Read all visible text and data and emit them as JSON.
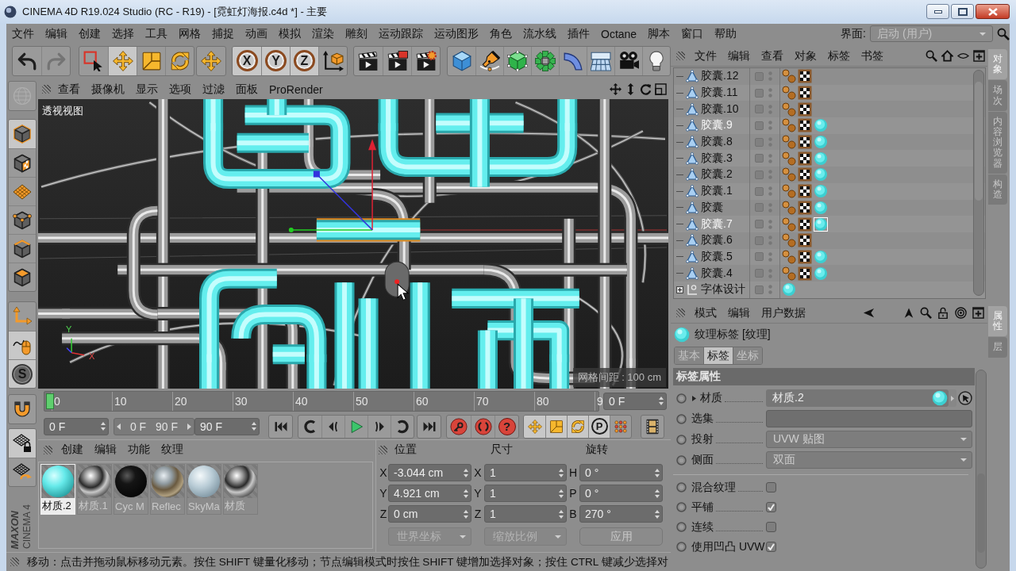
{
  "window": {
    "title": "CINEMA 4D R19.024 Studio (RC - R19) - [霓虹灯海报.c4d *] - 主要"
  },
  "menu_bar": {
    "items": [
      "文件",
      "编辑",
      "创建",
      "选择",
      "工具",
      "网格",
      "捕捉",
      "动画",
      "模拟",
      "渲染",
      "雕刻",
      "运动跟踪",
      "运动图形",
      "角色",
      "流水线",
      "插件",
      "Octane",
      "脚本",
      "窗口",
      "帮助"
    ],
    "layout_label": "界面:",
    "layout_value": "启动 (用户)"
  },
  "toolbar": {
    "groups": [
      [
        {
          "kind": "undo",
          "selected": false,
          "disabled": false
        },
        {
          "kind": "redo",
          "selected": false,
          "disabled": true
        }
      ],
      [
        {
          "kind": "select",
          "selected": false
        },
        {
          "kind": "move",
          "selected": true
        },
        {
          "kind": "scale",
          "selected": false
        },
        {
          "kind": "rotate",
          "selected": false
        }
      ],
      [
        {
          "kind": "move",
          "selected": false
        }
      ],
      [
        {
          "kind": "axis",
          "label": "X",
          "selected": true
        },
        {
          "kind": "axis",
          "label": "Y",
          "selected": true
        },
        {
          "kind": "axis",
          "label": "Z",
          "selected": true
        },
        {
          "kind": "world",
          "selected": false
        }
      ],
      [
        {
          "kind": "clapper",
          "selected": false
        },
        {
          "kind": "viewer",
          "selected": false
        },
        {
          "kind": "settings",
          "selected": false
        }
      ],
      [
        {
          "kind": "cube",
          "selected": false
        },
        {
          "kind": "pen",
          "selected": false
        },
        {
          "kind": "subdivide",
          "selected": false
        },
        {
          "kind": "cloner",
          "selected": false
        },
        {
          "kind": "bend",
          "selected": false
        },
        {
          "kind": "floor",
          "selected": false
        },
        {
          "kind": "camera",
          "selected": false
        },
        {
          "kind": "light",
          "selected": false
        }
      ]
    ]
  },
  "side_tools": {
    "groups": [
      [
        {
          "kind": "editable",
          "selected": false,
          "disabled": true
        }
      ],
      [
        {
          "kind": "model",
          "selected": true
        },
        {
          "kind": "texture",
          "selected": false
        },
        {
          "kind": "workplane",
          "selected": false
        },
        {
          "kind": "points",
          "selected": false
        },
        {
          "kind": "edges",
          "selected": false
        },
        {
          "kind": "polygons",
          "selected": false
        }
      ],
      [
        {
          "kind": "origin",
          "selected": false
        },
        {
          "kind": "tweak",
          "selected": true
        },
        {
          "kind": "solo",
          "label": "S",
          "selected": true
        }
      ],
      [
        {
          "kind": "snap",
          "selected": false
        }
      ],
      [
        {
          "kind": "lock",
          "selected": true
        },
        {
          "kind": "planar",
          "selected": false
        }
      ]
    ]
  },
  "logo": {
    "brand": "MAXON",
    "product": "CINEMA 4"
  },
  "viewport": {
    "menu": [
      "查看",
      "摄像机",
      "显示",
      "选项",
      "过滤",
      "面板",
      "ProRender"
    ],
    "camera_label": "透视视图",
    "axis_labels": [
      "Y",
      "X"
    ],
    "grid_spacing": "网格间距 : 100 cm"
  },
  "timeline": {
    "ticks": [
      "0",
      "10",
      "20",
      "30",
      "40",
      "50",
      "60",
      "70",
      "80",
      "9"
    ],
    "level": 0,
    "current_frame": "0 F"
  },
  "playback": {
    "start": "0 F",
    "preview": {
      "start": "0 F",
      "end": "90 F",
      "disabled": true
    },
    "end": "90 F",
    "record": [
      {
        "kind": "key"
      },
      {
        "kind": "auto"
      },
      {
        "kind": "pick",
        "label": "?"
      }
    ],
    "key_modes": [
      {
        "kind": "move",
        "selected": true
      },
      {
        "kind": "scale",
        "selected": true
      },
      {
        "kind": "rotate",
        "selected": true
      },
      {
        "kind": "param",
        "label": "P",
        "selected": true
      },
      {
        "kind": "points",
        "selected": false
      }
    ]
  },
  "materials": {
    "menu": [
      "创建",
      "编辑",
      "功能",
      "纹理"
    ],
    "items": [
      {
        "name": "材质.2",
        "kind": "glow",
        "selected": true
      },
      {
        "name": "材质.1",
        "kind": "chrome",
        "selected": false
      },
      {
        "name": "Cyc M",
        "kind": "black",
        "selected": false
      },
      {
        "name": "Reflec",
        "kind": "landscape",
        "selected": false
      },
      {
        "name": "SkyMa",
        "kind": "sky",
        "selected": false
      },
      {
        "name": "材质",
        "kind": "chrome",
        "selected": false
      }
    ]
  },
  "coordinates": {
    "headers": [
      "位置",
      "尺寸",
      "旋转"
    ],
    "rows": [
      {
        "cells": [
          {
            "axis": "X",
            "value": "-3.044 cm"
          },
          {
            "axis": "X",
            "value": "1"
          },
          {
            "axis": "H",
            "value": "0 °"
          }
        ]
      },
      {
        "cells": [
          {
            "axis": "Y",
            "value": "4.921 cm"
          },
          {
            "axis": "Y",
            "value": "1"
          },
          {
            "axis": "P",
            "value": "0 °"
          }
        ]
      },
      {
        "cells": [
          {
            "axis": "Z",
            "value": "0 cm"
          },
          {
            "axis": "Z",
            "value": "1"
          },
          {
            "axis": "B",
            "value": "270 °"
          }
        ]
      }
    ],
    "space": "世界坐标",
    "scale": "缩放比例",
    "apply": "应用"
  },
  "status_bar": {
    "text": "移动：点击并拖动鼠标移动元素。按住 SHIFT 键量化移动；节点编辑模式时按住 SHIFT 键增加选择对象；按住 CTRL 键减少选择对"
  },
  "objects": {
    "menu": [
      "文件",
      "编辑",
      "查看",
      "对象",
      "标签",
      "书签"
    ],
    "rows": [
      {
        "name": "胶囊.12",
        "kind": "capsule",
        "selected": false,
        "tags": [
          {
            "kind": "orbs",
            "selected": false
          },
          {
            "kind": "checker",
            "selected": false
          }
        ]
      },
      {
        "name": "胶囊.11",
        "kind": "capsule",
        "selected": false,
        "tags": [
          {
            "kind": "orbs",
            "selected": false
          },
          {
            "kind": "checker",
            "selected": false
          }
        ]
      },
      {
        "name": "胶囊.10",
        "kind": "capsule",
        "selected": false,
        "tags": [
          {
            "kind": "orbs",
            "selected": false
          },
          {
            "kind": "checker",
            "selected": false
          }
        ]
      },
      {
        "name": "胶囊.9",
        "kind": "capsule",
        "selected": true,
        "tags": [
          {
            "kind": "orbs",
            "selected": false
          },
          {
            "kind": "checker",
            "selected": false
          },
          {
            "kind": "material",
            "selected": false
          }
        ]
      },
      {
        "name": "胶囊.8",
        "kind": "capsule",
        "selected": false,
        "tags": [
          {
            "kind": "orbs",
            "selected": false
          },
          {
            "kind": "checker",
            "selected": false
          },
          {
            "kind": "material",
            "selected": false
          }
        ]
      },
      {
        "name": "胶囊.3",
        "kind": "capsule",
        "selected": false,
        "tags": [
          {
            "kind": "orbs",
            "selected": false
          },
          {
            "kind": "checker",
            "selected": false
          },
          {
            "kind": "material",
            "selected": false
          }
        ]
      },
      {
        "name": "胶囊.2",
        "kind": "capsule",
        "selected": false,
        "tags": [
          {
            "kind": "orbs",
            "selected": false
          },
          {
            "kind": "checker",
            "selected": false
          },
          {
            "kind": "material",
            "selected": false
          }
        ]
      },
      {
        "name": "胶囊.1",
        "kind": "capsule",
        "selected": false,
        "tags": [
          {
            "kind": "orbs",
            "selected": false
          },
          {
            "kind": "checker",
            "selected": false
          },
          {
            "kind": "material",
            "selected": false
          }
        ]
      },
      {
        "name": "胶囊",
        "kind": "capsule",
        "selected": false,
        "tags": [
          {
            "kind": "orbs",
            "selected": false
          },
          {
            "kind": "checker",
            "selected": false
          },
          {
            "kind": "material",
            "selected": false
          }
        ]
      },
      {
        "name": "胶囊.7",
        "kind": "capsule",
        "selected": true,
        "tags": [
          {
            "kind": "orbs",
            "selected": false
          },
          {
            "kind": "checker",
            "selected": false
          },
          {
            "kind": "material",
            "selected": true
          }
        ]
      },
      {
        "name": "胶囊.6",
        "kind": "capsule",
        "selected": false,
        "tags": [
          {
            "kind": "orbs",
            "selected": false
          },
          {
            "kind": "checker",
            "selected": false
          }
        ]
      },
      {
        "name": "胶囊.5",
        "kind": "capsule",
        "selected": false,
        "tags": [
          {
            "kind": "orbs",
            "selected": false
          },
          {
            "kind": "checker",
            "selected": false
          },
          {
            "kind": "material",
            "selected": false
          }
        ]
      },
      {
        "name": "胶囊.4",
        "kind": "capsule",
        "selected": false,
        "tags": [
          {
            "kind": "orbs",
            "selected": false
          },
          {
            "kind": "checker",
            "selected": false
          },
          {
            "kind": "material",
            "selected": false
          }
        ]
      },
      {
        "name": "字体设计",
        "kind": "null",
        "expanded": false,
        "selected": false,
        "tags": [
          {
            "kind": "material",
            "selected": false
          }
        ]
      }
    ],
    "side_tabs": [
      {
        "label": "对象",
        "selected": true
      },
      {
        "label": "场次",
        "selected": false
      },
      {
        "label": "内容浏览器",
        "selected": false
      },
      {
        "label": "构造",
        "selected": false
      }
    ]
  },
  "attributes": {
    "menu": [
      "模式",
      "编辑",
      "用户数据"
    ],
    "title": "纹理标签 [纹理]",
    "tabs": [
      {
        "label": "基本",
        "selected": false
      },
      {
        "label": "标签",
        "selected": true
      },
      {
        "label": "坐标",
        "selected": false
      }
    ],
    "section": "标签属性",
    "fields": [
      {
        "kind": "link",
        "label": "材质",
        "value": "材质.2",
        "expanded": false
      },
      {
        "kind": "text",
        "label": "选集"
      },
      {
        "kind": "dropdown",
        "label": "投射",
        "value": "UVW 贴图"
      },
      {
        "kind": "dropdown",
        "label": "侧面",
        "value": "双面"
      }
    ],
    "options": [
      {
        "label": "混合纹理",
        "checked": false
      },
      {
        "label": "平铺",
        "checked": true
      },
      {
        "label": "连续",
        "checked": false
      },
      {
        "label": "使用凹凸 UVW",
        "checked": true
      }
    ],
    "side_tabs": [
      {
        "label": "属性",
        "selected": true
      },
      {
        "label": "层",
        "selected": false
      }
    ]
  }
}
